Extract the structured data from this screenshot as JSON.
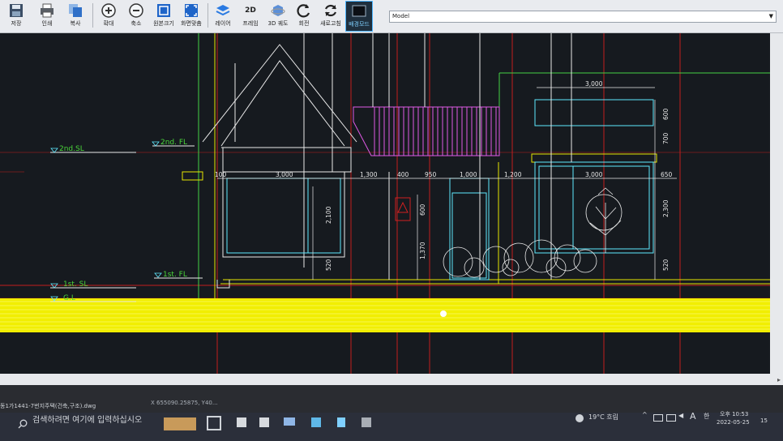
{
  "toolbar": {
    "buttons": [
      {
        "id": "save",
        "label": "저장",
        "icon": "save-icon"
      },
      {
        "id": "print",
        "label": "인쇄",
        "icon": "printer-icon"
      },
      {
        "id": "copy",
        "label": "복사",
        "icon": "copy-icon"
      },
      {
        "id": "zoom_in",
        "label": "확대",
        "icon": "zoom-in-icon"
      },
      {
        "id": "zoom_out",
        "label": "축소",
        "icon": "zoom-out-icon"
      },
      {
        "id": "original_size",
        "label": "원본크기",
        "icon": "original-size-icon"
      },
      {
        "id": "fit_screen",
        "label": "화면맞춤",
        "icon": "fit-screen-icon"
      },
      {
        "id": "layer",
        "label": "레이어",
        "icon": "layers-icon"
      },
      {
        "id": "frame_2d",
        "label": "프레임",
        "icon_text": "2D"
      },
      {
        "id": "orbit_3d",
        "label": "3D 궤도",
        "icon": "orbit-3d-icon"
      },
      {
        "id": "rotate",
        "label": "회전",
        "icon": "rotate-icon"
      },
      {
        "id": "refresh",
        "label": "새로고침",
        "icon": "refresh-icon"
      },
      {
        "id": "background_mode",
        "label": "배경모드",
        "icon": "background-mode-icon",
        "active": true
      }
    ],
    "model_select": {
      "value": "Model"
    }
  },
  "drawing": {
    "levels": {
      "second_sl": "2nd.SL",
      "second_fl": "2nd. FL",
      "first_sl": "1st. SL",
      "first_fl": "1st. FL",
      "gl": "G.L"
    },
    "dims_top": [
      "3,000"
    ],
    "dims_row": [
      "100",
      "3,000",
      "1,300",
      "400",
      "950",
      "1,000",
      "1,200",
      "3,000",
      "650"
    ],
    "dims_vertical": [
      "600",
      "700",
      "2,100",
      "520",
      "600",
      "1,370",
      "2,300",
      "520"
    ]
  },
  "status": {
    "file_name": "동1가1441-7번지주택(건축,구조).dwg",
    "coords": "X 655090.25875, Y40..."
  },
  "taskbar": {
    "search_placeholder": "검색하려면 여기에 입력하십시오",
    "weather": "19°C 흐림",
    "ime": "A",
    "lang": "한",
    "time": "오후 10:53",
    "date": "2022-05-25",
    "notifications": "15"
  },
  "colors": {
    "canvas": "#161a1f",
    "ground_hatch": "#f4f100",
    "dim_cyan": "#5fe9ff",
    "wall_white": "#e9e9e9",
    "magenta": "#e059e6",
    "red_line": "#d02020",
    "active_button": "#4db6ff"
  }
}
